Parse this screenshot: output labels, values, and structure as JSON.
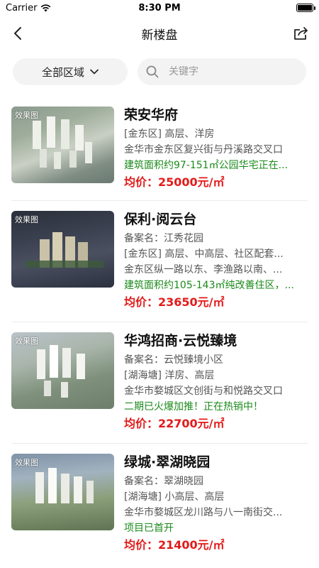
{
  "status": {
    "carrier": "Carrier",
    "time": "8:30 PM"
  },
  "nav": {
    "title": "新楼盘"
  },
  "filter": {
    "region_label": "全部区域",
    "search_placeholder": "关键字"
  },
  "price_prefix": "均价：",
  "listings": [
    {
      "badge": "效果图",
      "name": "荣安华府",
      "lines": [
        {
          "text": "[金东区] 高层、洋房",
          "color": "gray"
        },
        {
          "text": "金华市金东区复兴街与丹溪路交叉口",
          "color": "gray"
        },
        {
          "text": "建筑面积约97-151㎡公园华宅正在...",
          "color": "green"
        }
      ],
      "price": "25000元/㎡"
    },
    {
      "badge": "效果图",
      "name": "保利·阅云台",
      "lines": [
        {
          "text": "备案名：江秀花园",
          "color": "gray"
        },
        {
          "text": "[金东区] 高层、中高层、社区配套...",
          "color": "gray"
        },
        {
          "text": "金东区纵一路以东、李渔路以南、...",
          "color": "gray"
        },
        {
          "text": "建筑面积约105-143㎡纯改善住区，...",
          "color": "green"
        }
      ],
      "price": "23650元/㎡"
    },
    {
      "badge": "效果图",
      "name": "华鸿招商·云悦臻境",
      "lines": [
        {
          "text": "备案名：云悦臻境小区",
          "color": "gray"
        },
        {
          "text": "[湖海塘] 洋房、高层",
          "color": "gray"
        },
        {
          "text": "金华市婺城区文创街与和悦路交叉口",
          "color": "gray"
        },
        {
          "text": "二期已火爆加推！正在热销中！",
          "color": "green"
        }
      ],
      "price": "22700元/㎡"
    },
    {
      "badge": "效果图",
      "name": "绿城·翠湖晓园",
      "lines": [
        {
          "text": "备案名：翠湖晓园",
          "color": "gray"
        },
        {
          "text": "[湖海塘] 小高层、高层",
          "color": "gray"
        },
        {
          "text": "金华市婺城区龙川路与八一南街交...",
          "color": "gray"
        },
        {
          "text": "项目已首开",
          "color": "green"
        }
      ],
      "price": "21400元/㎡"
    }
  ],
  "colors": {
    "accent_green": "#1a8a1a",
    "price_red": "#e21a1a"
  }
}
